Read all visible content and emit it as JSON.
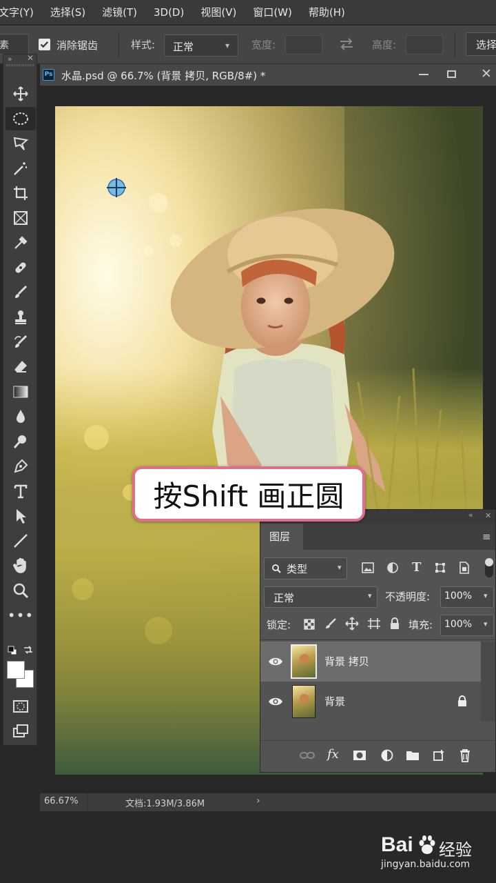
{
  "menu": [
    "文字(Y)",
    "选择(S)",
    "滤镜(T)",
    "3D(D)",
    "视图(V)",
    "窗口(W)",
    "帮助(H)"
  ],
  "options": {
    "partial_left": "素",
    "antialias_label": "消除锯齿",
    "style_label": "样式:",
    "style_value": "正常",
    "width_label": "宽度:",
    "height_label": "高度:",
    "select_button": "选择"
  },
  "document": {
    "tab_title": "水晶.psd @ 66.7% (背景 拷贝, RGB/8#) *",
    "ps_badge": "Ps",
    "zoom": "66.67%",
    "doc_info": "文档:1.93M/3.86M"
  },
  "caption": "按Shift 画正圆",
  "layers_panel": {
    "tab": "图层",
    "filter_kind": "类型",
    "blend_mode": "正常",
    "opacity_label": "不透明度:",
    "opacity_value": "100%",
    "lock_label": "锁定:",
    "fill_label": "填充:",
    "fill_value": "100%",
    "layers": [
      {
        "name": "背景 拷贝",
        "visible": true,
        "selected": true
      },
      {
        "name": "背景",
        "visible": true,
        "locked": true
      }
    ]
  },
  "watermark": {
    "brand": "Bai",
    "brand_cn": "经验",
    "url": "jingyan.baidu.com"
  },
  "colors": {
    "accent_pink": "#e06f8e",
    "panel": "#535353",
    "selected_layer": "#6c6c6c"
  }
}
